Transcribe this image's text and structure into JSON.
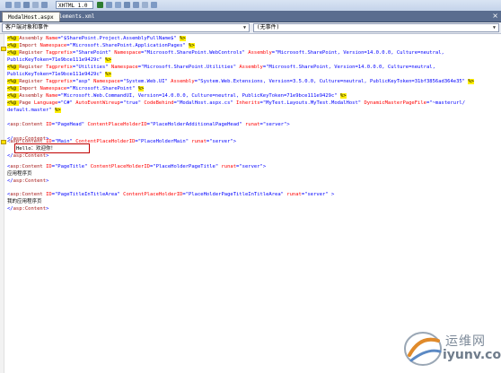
{
  "toolbar": {
    "schema_label": "XHTML 1.0 Transitio"
  },
  "tabs": [
    {
      "label": "ModalHost.aspx"
    },
    {
      "label": "Elements.xml"
    }
  ],
  "navbar": {
    "object_label": "客户端对象和事件",
    "event_label": "(无事件)"
  },
  "code": {
    "l1": {
      "a": "<%@ ",
      "b": "Assembly ",
      "c": "Name",
      "d": "=\"$SharePoint.Project.AssemblyFullName$\" ",
      "e": "%>"
    },
    "l2": {
      "a": "<%@ ",
      "b": "Import ",
      "c": "Namespace",
      "d": "=\"Microsoft.SharePoint.ApplicationPages\" ",
      "e": "%>"
    },
    "l3": {
      "a": "<%@ ",
      "b": "Register ",
      "c1": "Tagprefix",
      "d1": "=\"SharePoint\" ",
      "c2": "Namespace",
      "d2": "=\"Microsoft.SharePoint.WebControls\" ",
      "c3": "Assembly",
      "d3": "=\"Microsoft.SharePoint, Version=14.0.0.0, Culture=neutral,"
    },
    "l4": {
      "a": "PublicKeyToken=71e9bce111e9429c\" ",
      "e": "%>"
    },
    "l5": {
      "a": "<%@ ",
      "b": "Register ",
      "c1": "Tagprefix",
      "d1": "=\"Utilities\" ",
      "c2": "Namespace",
      "d2": "=\"Microsoft.SharePoint.Utilities\" ",
      "c3": "Assembly",
      "d3": "=\"Microsoft.SharePoint, Version=14.0.0.0, Culture=neutral,"
    },
    "l6": {
      "a": "PublicKeyToken=71e9bce111e9429c\" ",
      "e": "%>"
    },
    "l7": {
      "a": "<%@ ",
      "b": "Register ",
      "c1": "Tagprefix",
      "d1": "=\"asp\" ",
      "c2": "Namespace",
      "d2": "=\"System.Web.UI\" ",
      "c3": "Assembly",
      "d3": "=\"System.Web.Extensions, Version=3.5.0.0, Culture=neutral, PublicKeyToken=31bf3856ad364e35\" ",
      "e": "%>"
    },
    "l8": {
      "a": "<%@ ",
      "b": "Import ",
      "c": "Namespace",
      "d": "=\"Microsoft.SharePoint\" ",
      "e": "%>"
    },
    "l9": {
      "a": "<%@ ",
      "b": "Assembly ",
      "c": "Name",
      "d": "=\"Microsoft.Web.CommandUI, Version=14.0.0.0, Culture=neutral, PublicKeyToken=71e9bce111e9429c\" ",
      "e": "%>"
    },
    "l10": {
      "a": "<%@ ",
      "b": "Page ",
      "c1": "Language",
      "d1": "=\"C#\" ",
      "c2": "AutoEventWireup",
      "d2": "=\"true\" ",
      "c3": "CodeBehind",
      "d3": "=\"ModalHost.aspx.cs\" ",
      "c4": "Inherits",
      "d4": "=\"MyTest.Layouts.MyTest.ModalHost\" ",
      "c5": "DynamicMasterPageFile",
      "d5": "=\"~masterurl/"
    },
    "l11": {
      "a": "default.master\" ",
      "e": "%>"
    },
    "l13": {
      "a": "<",
      "b": "asp:Content ",
      "c1": "ID",
      "d1": "=\"PageHead\" ",
      "c2": "ContentPlaceHolderID",
      "d2": "=\"PlaceHolderAdditionalPageHead\" ",
      "c3": "runat",
      "d3": "=\"server\"",
      "e": ">"
    },
    "l15": {
      "a": "</",
      "b": "asp:Content",
      "e": ">"
    },
    "l17": {
      "a": "<",
      "b": "asp:Content ",
      "c1": "ID",
      "d1": "=\"Main\" ",
      "c2": "ContentPlaceHolderID",
      "d2": "=\"PlaceHolderMain\" ",
      "c3": "runat",
      "d3": "=\"server\"",
      "e": ">"
    },
    "l18": {
      "t": "Hello：欢迎你！"
    },
    "l19": {
      "a": "</",
      "b": "asp:Content",
      "e": ">"
    },
    "l21": {
      "a": "<",
      "b": "asp:Content ",
      "c1": "ID",
      "d1": "=\"PageTitle\" ",
      "c2": "ContentPlaceHolderID",
      "d2": "=\"PlaceHolderPageTitle\" ",
      "c3": "runat",
      "d3": "=\"server\"",
      "e": ">"
    },
    "l22": {
      "t": "应用程序页"
    },
    "l23": {
      "a": "</",
      "b": "asp:Content",
      "e": ">"
    },
    "l25": {
      "a": "<",
      "b": "asp:Content ",
      "c1": "ID",
      "d1": "=\"PageTitleInTitleArea\" ",
      "c2": "ContentPlaceHolderID",
      "d2": "=\"PlaceHolderPageTitleInTitleArea\" ",
      "c3": "runat",
      "d3": "=\"server\" ",
      "e": ">"
    },
    "l26": {
      "t": "我的应用程序页"
    },
    "l27": {
      "a": "</",
      "b": "asp:Content",
      "e": ">"
    }
  },
  "watermark": {
    "cn": "运维网",
    "url": "iyunv.com"
  }
}
